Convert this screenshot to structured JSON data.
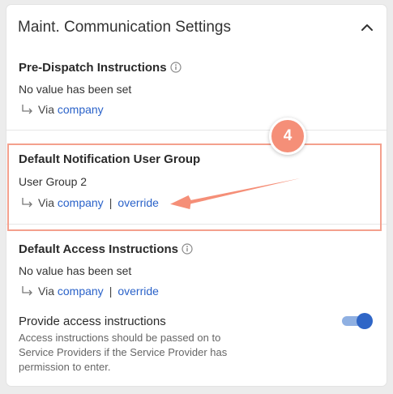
{
  "panel": {
    "title": "Maint. Communication Settings",
    "collapse_icon": "chevron-up-icon"
  },
  "sections": [
    {
      "title": "Pre-Dispatch Instructions",
      "has_info_icon": true,
      "value": "No value has been set",
      "via_prefix": "Via",
      "via_link": "company"
    },
    {
      "title": "Default Notification User Group",
      "has_info_icon": false,
      "value": "User Group 2",
      "via_prefix": "Via",
      "via_link": "company",
      "separator": "|",
      "override_link": "override"
    },
    {
      "title": "Default Access Instructions",
      "has_info_icon": true,
      "value": "No value has been set",
      "via_prefix": "Via",
      "via_link": "company",
      "separator": "|",
      "override_link": "override"
    }
  ],
  "access_toggle": {
    "label": "Provide access instructions",
    "help": "Access instructions should be passed on to Service Providers if the Service Provider has permission to enter.",
    "checked": true
  },
  "annotation": {
    "step_number": "4",
    "color": "#f58f78"
  },
  "colors": {
    "link": "#2a62c9",
    "toggle_on": "#2f66c7",
    "highlight": "#f4a08d"
  }
}
